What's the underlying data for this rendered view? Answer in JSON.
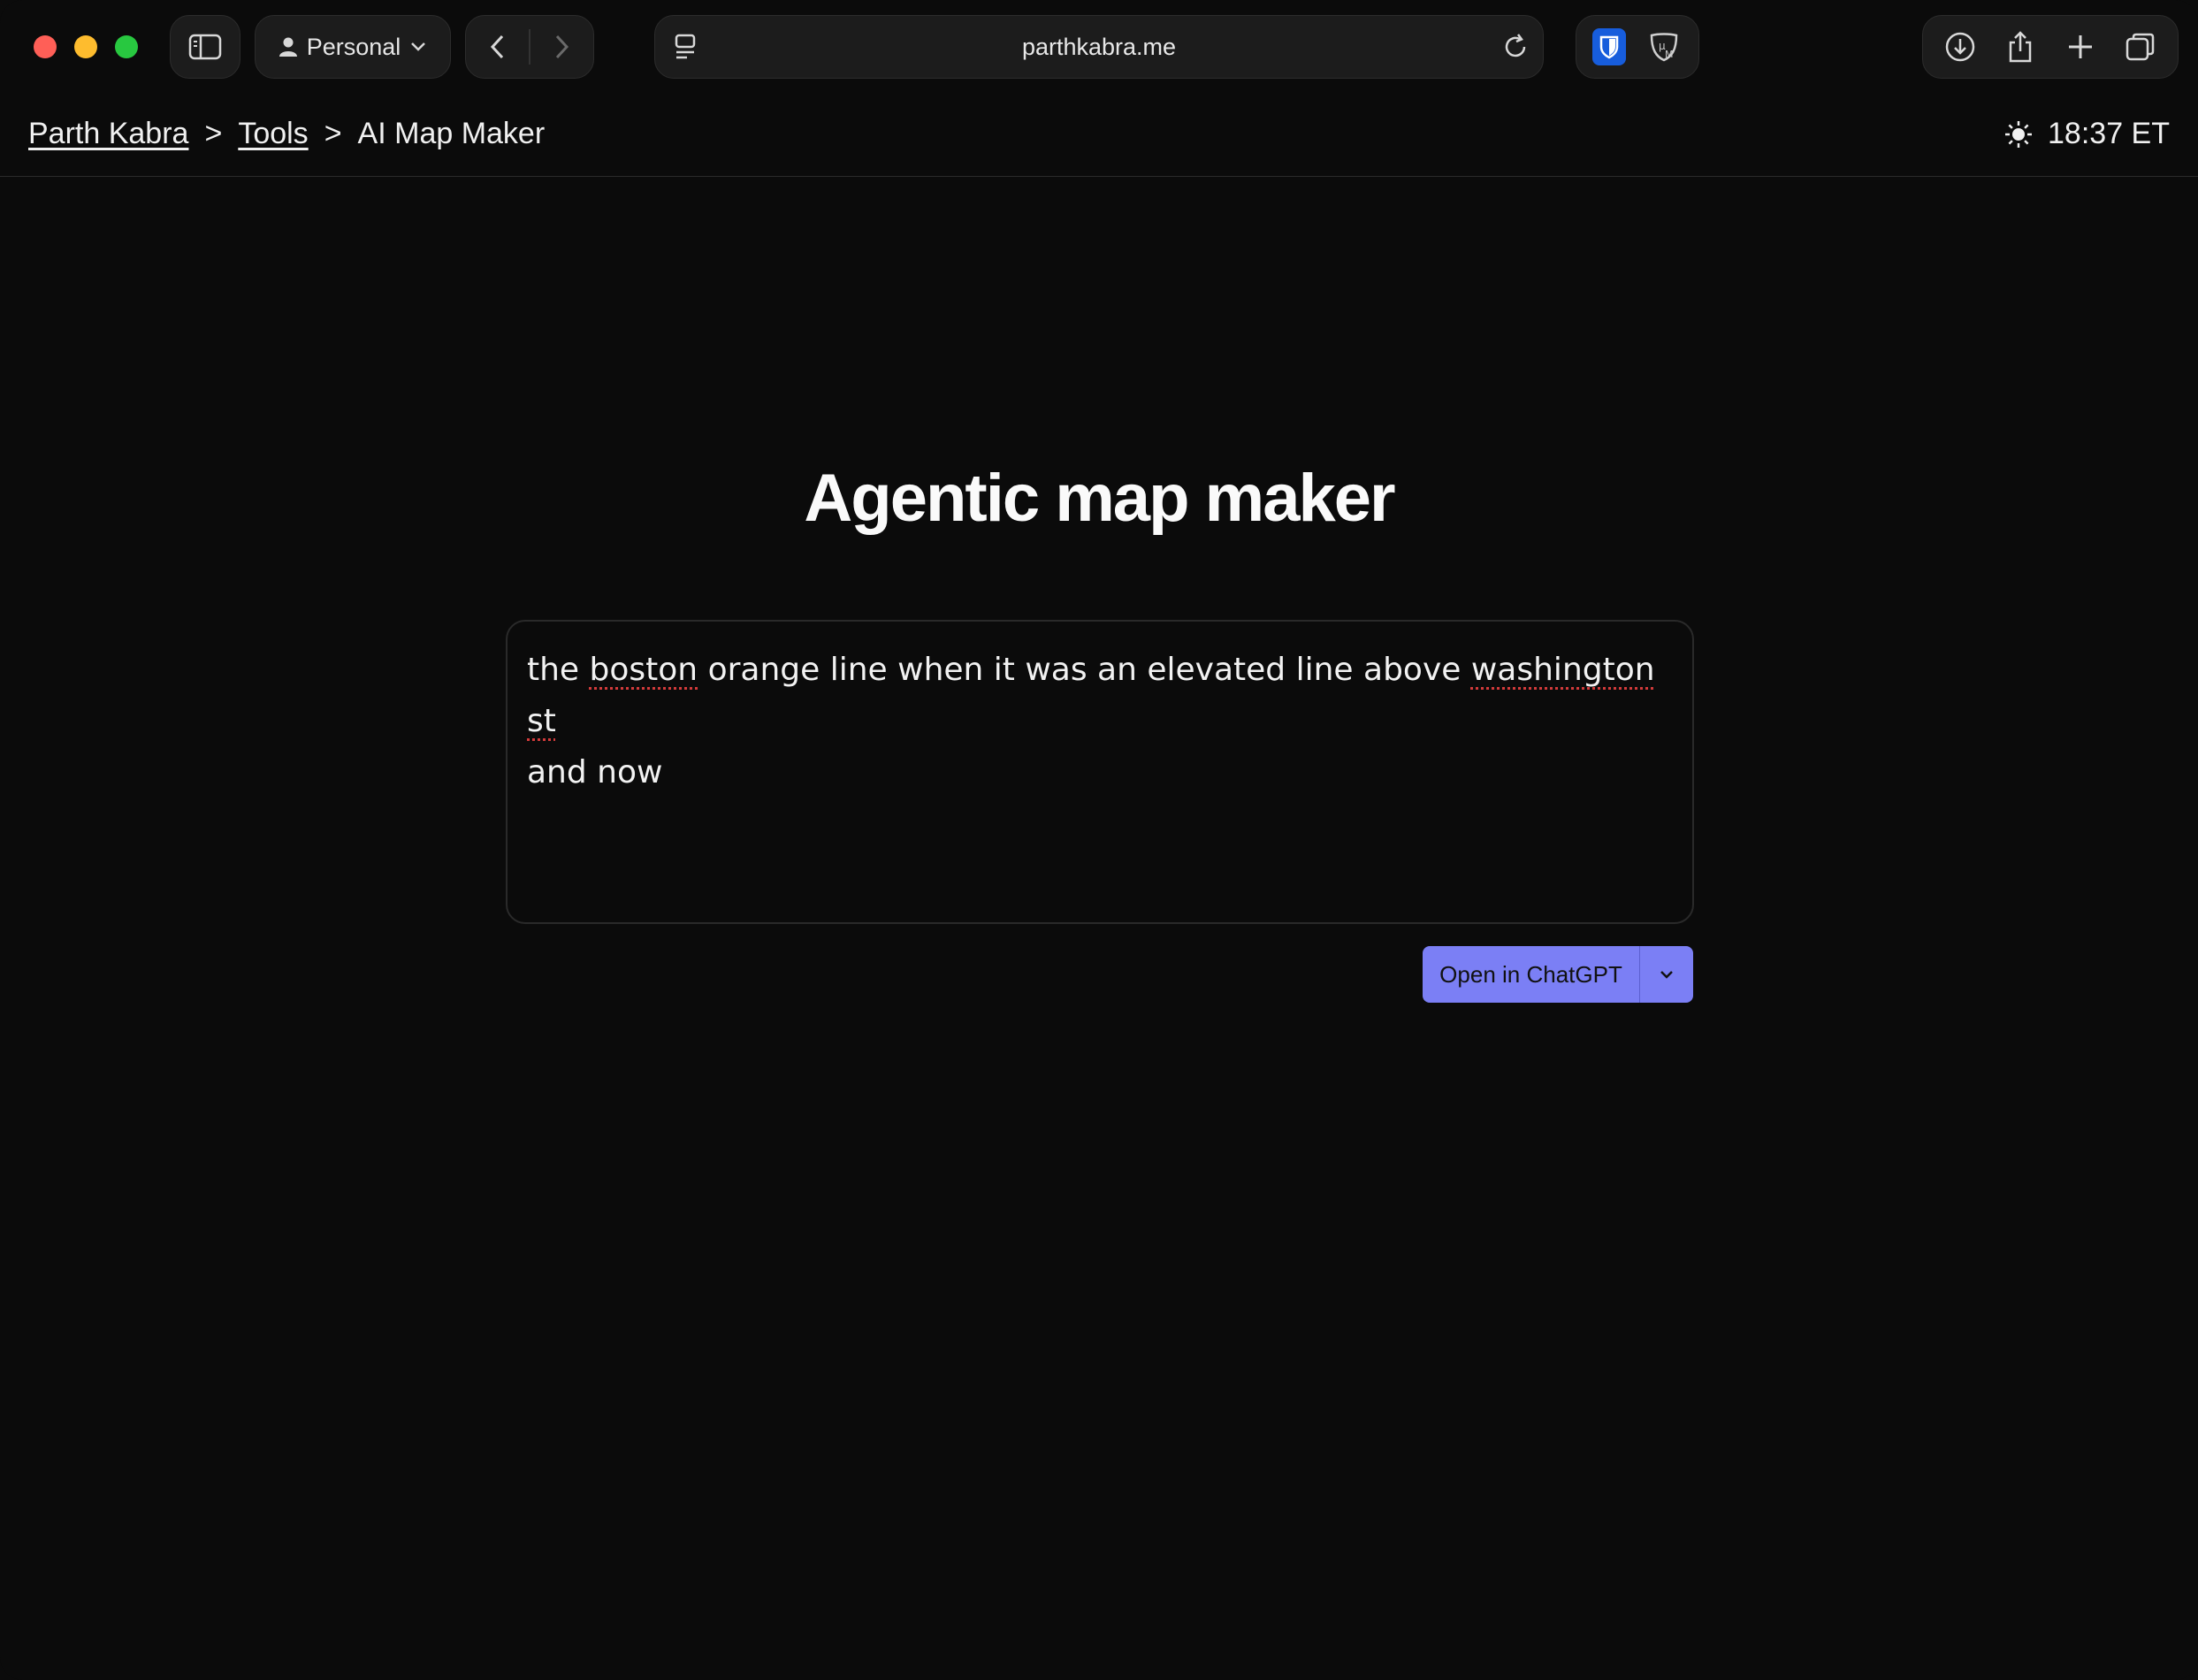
{
  "browser": {
    "profile_label": "Personal",
    "address": "parthkabra.me"
  },
  "breadcrumb": {
    "home": "Parth Kabra",
    "separator": ">",
    "tools": "Tools",
    "current": "AI Map Maker"
  },
  "clock": {
    "time": "18:37 ET",
    "theme_icon": "sun-icon"
  },
  "main": {
    "title": "Agentic map maker",
    "prompt_line1_parts": [
      "the ",
      "boston",
      " orange line when it was an elevated line above ",
      "washington",
      " ",
      "st"
    ],
    "prompt_line2": "and now",
    "action_label": "Open in ChatGPT"
  },
  "colors": {
    "background": "#0b0b0b",
    "accent": "#7b7ff5",
    "spellcheck": "#d23a3a"
  }
}
